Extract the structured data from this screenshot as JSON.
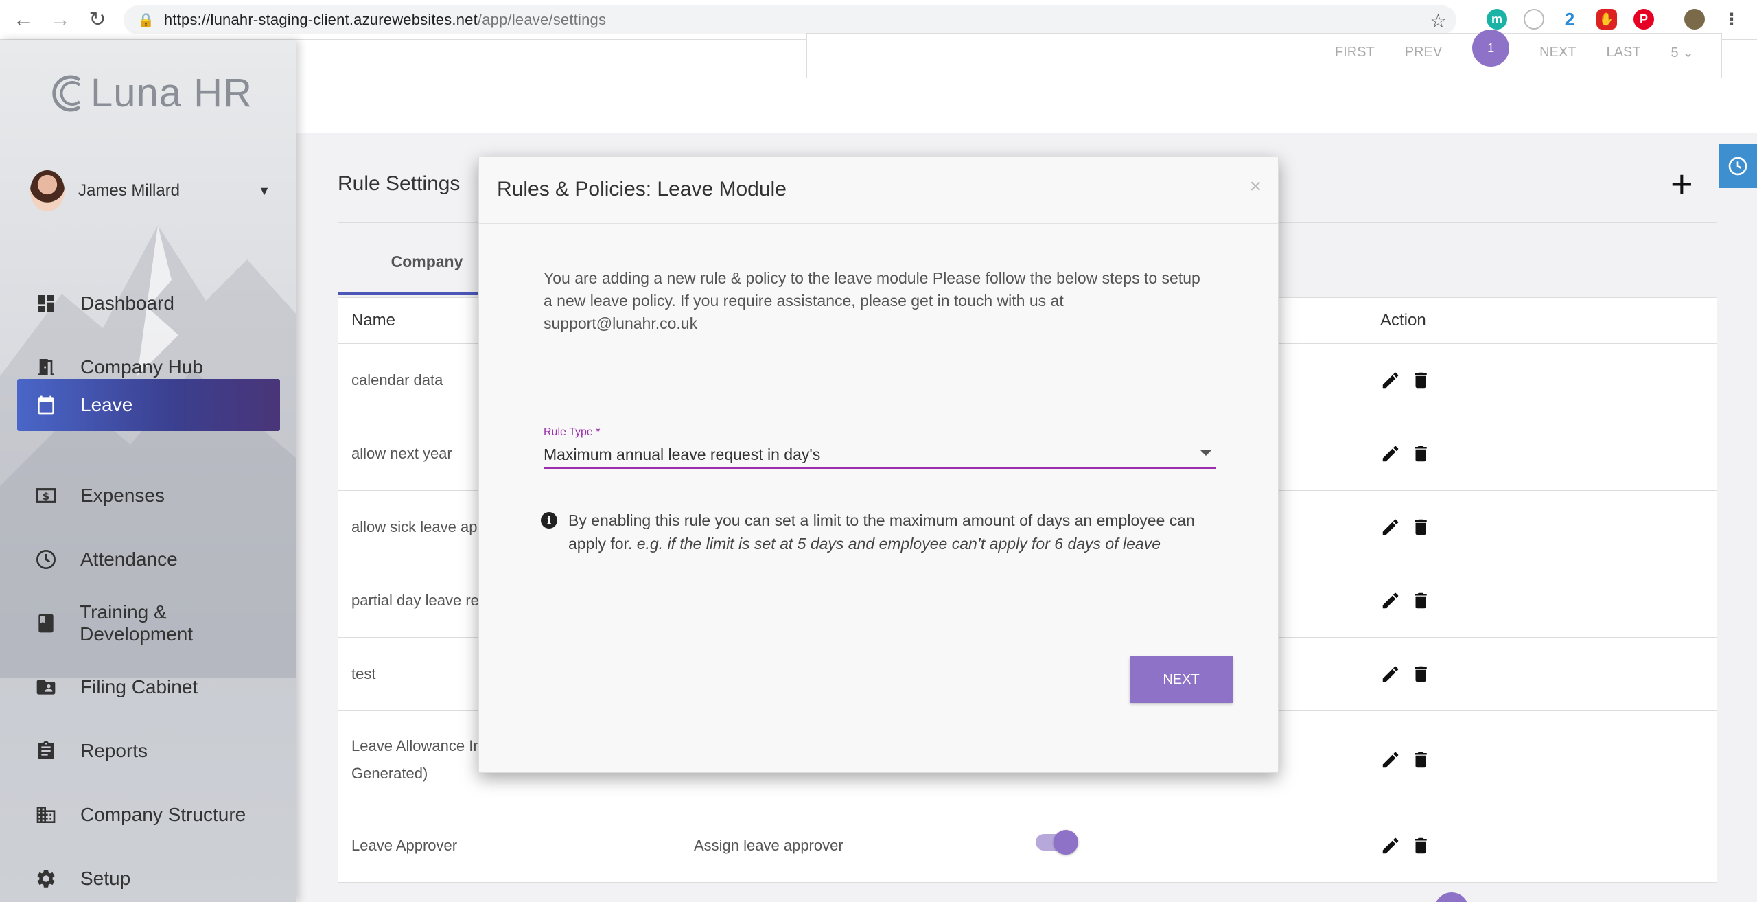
{
  "browser": {
    "url_host": "https://lunahr-staging-client.azurewebsites.net",
    "url_path": "/app/leave/settings"
  },
  "sidebar": {
    "logo": "Luna HR",
    "user_name": "James Millard",
    "items": [
      {
        "label": "Dashboard",
        "icon": "dashboard-icon"
      },
      {
        "label": "Company Hub",
        "icon": "door-icon"
      },
      {
        "label": "Leave",
        "icon": "calendar-icon",
        "active": true
      },
      {
        "label": "Expenses",
        "icon": "money-icon"
      },
      {
        "label": "Attendance",
        "icon": "clock-icon"
      },
      {
        "label": "Training & Development",
        "icon": "book-icon"
      },
      {
        "label": "Filing Cabinet",
        "icon": "folder-icon"
      },
      {
        "label": "Reports",
        "icon": "clipboard-icon"
      },
      {
        "label": "Company Structure",
        "icon": "building-icon"
      },
      {
        "label": "Setup",
        "icon": "gear-icon"
      }
    ]
  },
  "pager": {
    "first": "FIRST",
    "prev": "PREV",
    "current": "1",
    "next": "NEXT",
    "last": "LAST",
    "per_page": "5"
  },
  "page": {
    "title": "Rule Settings",
    "tab_company": "Company",
    "col_name": "Name",
    "col_action": "Action",
    "rows": [
      {
        "name": "calendar data",
        "description": ""
      },
      {
        "name": "allow next year",
        "description": ""
      },
      {
        "name": "allow sick leave app",
        "description": ""
      },
      {
        "name": "partial day leave re",
        "description": ""
      },
      {
        "name": "test",
        "description": ""
      },
      {
        "name": "Leave Allowance In Generated)",
        "description": ""
      },
      {
        "name": "Leave Approver",
        "description": "Assign leave approver",
        "toggle_on": true
      }
    ]
  },
  "modal": {
    "title": "Rules & Policies: Leave Module",
    "close": "×",
    "intro": "You are adding a new rule & policy to the leave module Please follow the below steps to setup a new leave policy. If you require assistance, please get in touch with us at support@lunahr.co.uk",
    "rule_type_label": "Rule Type *",
    "rule_type_value": "Maximum annual leave request in day's",
    "info_text": "By enabling this rule you can set a limit to the maximum amount of days an employee can apply for.",
    "info_example": "e.g. if the limit is set at 5 days and employee can’t apply for 6 days of leave",
    "next_label": "NEXT"
  },
  "colors": {
    "accent": "#8e72c8",
    "active_nav": "#3b3f8f",
    "select_underline": "#9c2fae"
  }
}
